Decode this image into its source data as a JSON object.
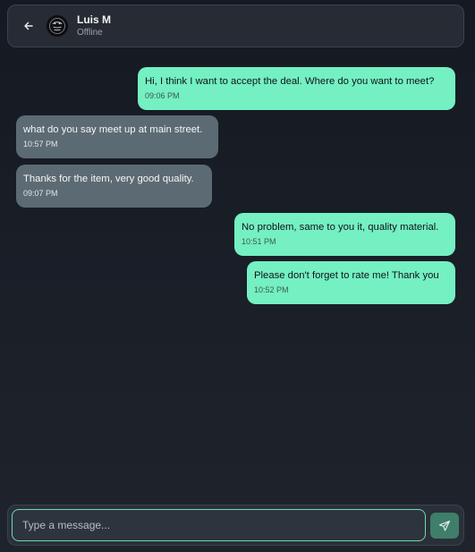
{
  "header": {
    "contact_name": "Luis M",
    "contact_status": "Offline",
    "back_icon": "arrow-left-icon",
    "avatar_icon": "avatar-icon"
  },
  "messages": [
    {
      "direction": "sent",
      "text": "Hi, I think I want to accept the deal. Where do you want to meet?",
      "time": "09:06 PM"
    },
    {
      "direction": "received",
      "text": "what do you say meet up at main street.",
      "time": "10:57 PM"
    },
    {
      "direction": "received",
      "text": "Thanks for the item, very good quality.",
      "time": "09:07 PM"
    },
    {
      "direction": "sent",
      "text": "No problem, same to you it, quality material.",
      "time": "10:51 PM"
    },
    {
      "direction": "sent",
      "text": "Please don't forget to rate me! Thank you",
      "time": "10:52 PM"
    }
  ],
  "composer": {
    "placeholder": "Type a message...",
    "value": "",
    "send_icon": "send-icon"
  },
  "colors": {
    "sent_bubble": "#74f0c2",
    "received_bubble": "#5c6b73",
    "accent": "#6fd9b3"
  }
}
